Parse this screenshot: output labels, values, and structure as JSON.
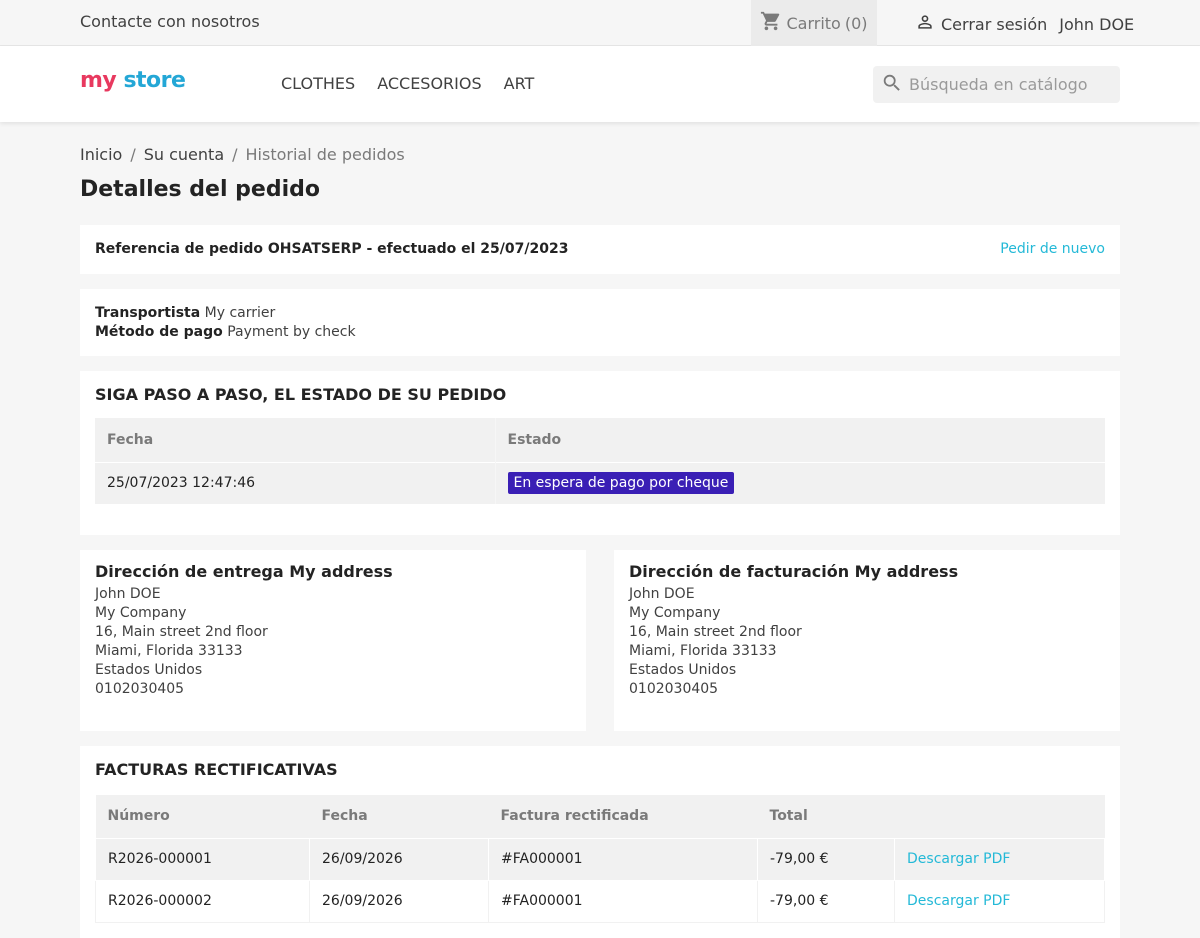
{
  "topbar": {
    "contact": "Contacte con nosotros",
    "cart_label": "Carrito",
    "cart_count": "(0)",
    "logout": "Cerrar sesión",
    "user_name": "John DOE"
  },
  "header": {
    "logo_part1": "my",
    "logo_part2": "store",
    "menu": [
      "CLOTHES",
      "ACCESORIOS",
      "ART"
    ],
    "search_placeholder": "Búsqueda en catálogo"
  },
  "breadcrumb": [
    "Inicio",
    "Su cuenta",
    "Historial de pedidos"
  ],
  "page_title": "Detalles del pedido",
  "order": {
    "reference": "Referencia de pedido OHSATSERP - efectuado el 25/07/2023",
    "reorder": "Pedir de nuevo",
    "carrier_label": "Transportista",
    "carrier_value": "My carrier",
    "payment_label": "Método de pago",
    "payment_value": "Payment by check"
  },
  "status": {
    "title": "SIGA PASO A PASO, EL ESTADO DE SU PEDIDO",
    "headers": [
      "Fecha",
      "Estado"
    ],
    "rows": [
      {
        "date": "25/07/2023 12:47:46",
        "state": "En espera de pago por cheque"
      }
    ],
    "badge_color": "#3a1fb5"
  },
  "delivery": {
    "title": "Dirección de entrega My address",
    "lines": [
      "John DOE",
      "My Company",
      "16, Main street 2nd floor",
      "Miami, Florida 33133",
      "Estados Unidos",
      "0102030405"
    ]
  },
  "billing": {
    "title": "Dirección de facturación My address",
    "lines": [
      "John DOE",
      "My Company",
      "16, Main street 2nd floor",
      "Miami, Florida 33133",
      "Estados Unidos",
      "0102030405"
    ]
  },
  "invoices": {
    "title": "FACTURAS RECTIFICATIVAS",
    "headers": [
      "Número",
      "Fecha",
      "Factura rectificada",
      "Total",
      ""
    ],
    "rows": [
      {
        "number": "R2026-000001",
        "date": "26/09/2026",
        "invoice": "#FA000001",
        "total": "-79,00 €",
        "link": "Descargar PDF"
      },
      {
        "number": "R2026-000002",
        "date": "26/09/2026",
        "invoice": "#FA000001",
        "total": "-79,00 €",
        "link": "Descargar PDF"
      }
    ],
    "link_color": "#24b9d7"
  }
}
